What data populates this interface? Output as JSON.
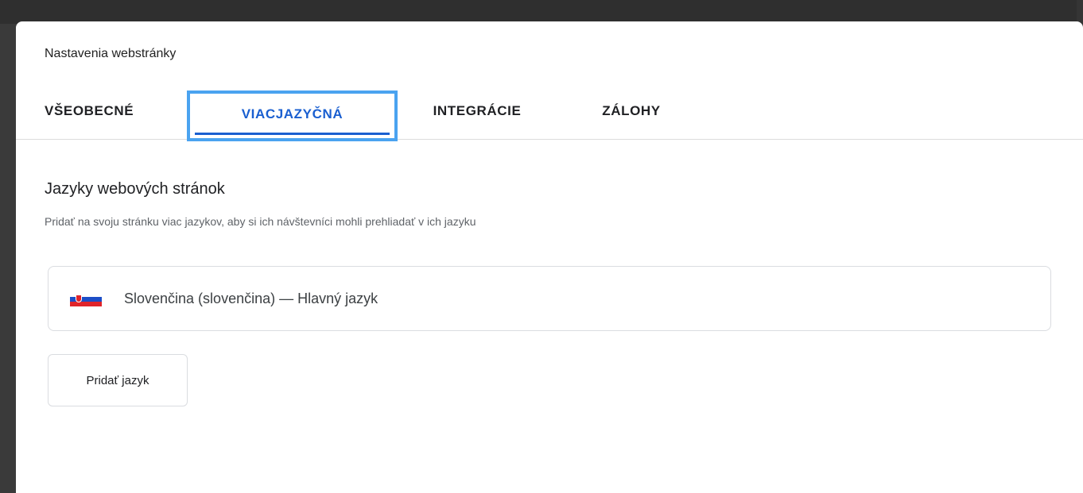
{
  "dialog": {
    "title": "Nastavenia webstránky"
  },
  "tabs": [
    {
      "label": "VŠEOBECNÉ",
      "active": false
    },
    {
      "label": "VIACJAZYČNÁ",
      "active": true
    },
    {
      "label": "INTEGRÁCIE",
      "active": false
    },
    {
      "label": "ZÁLOHY",
      "active": false
    }
  ],
  "section": {
    "heading": "Jazyky webových stránok",
    "subtitle": "Pridať na svoju stránku viac jazykov, aby si ich návštevníci mohli prehliadať v ich jazyku"
  },
  "languages": [
    {
      "flag": "slovakia-flag-icon",
      "label": "Slovenčina (slovenčina) — Hlavný jazyk"
    }
  ],
  "actions": {
    "add_language_label": "Pridať jazyk"
  },
  "colors": {
    "accent": "#1a5fd0",
    "focus_ring": "#4aa3f0"
  }
}
